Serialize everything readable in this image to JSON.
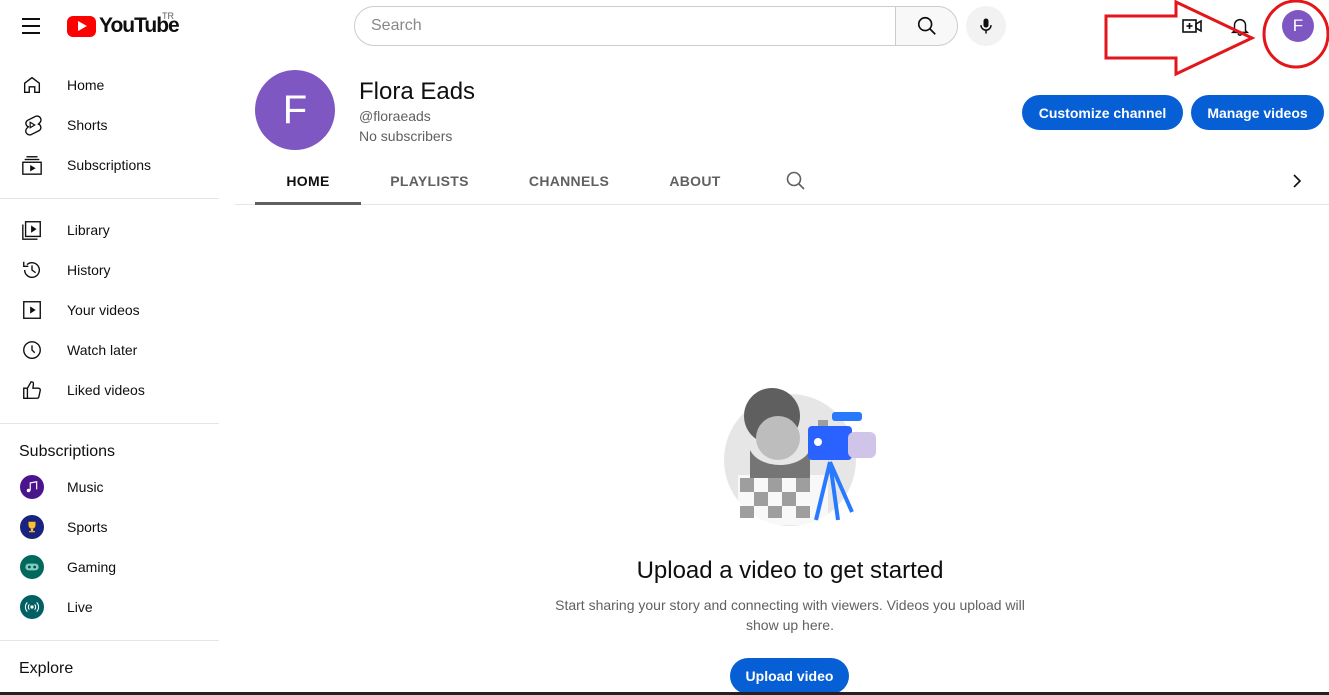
{
  "header": {
    "logo_text": "YouTube",
    "country_code": "TR",
    "search_placeholder": "Search",
    "avatar_letter": "F"
  },
  "sidebar": {
    "main_items": [
      {
        "label": "Home",
        "icon": "home-icon"
      },
      {
        "label": "Shorts",
        "icon": "shorts-icon"
      },
      {
        "label": "Subscriptions",
        "icon": "subscriptions-icon"
      }
    ],
    "library_items": [
      {
        "label": "Library",
        "icon": "library-icon"
      },
      {
        "label": "History",
        "icon": "history-icon"
      },
      {
        "label": "Your videos",
        "icon": "your-videos-icon"
      },
      {
        "label": "Watch later",
        "icon": "watch-later-icon"
      },
      {
        "label": "Liked videos",
        "icon": "liked-videos-icon"
      }
    ],
    "subscriptions_heading": "Subscriptions",
    "subscriptions": [
      {
        "label": "Music",
        "color": "#4a148c"
      },
      {
        "label": "Sports",
        "color": "#1a237e"
      },
      {
        "label": "Gaming",
        "color": "#00695c"
      },
      {
        "label": "Live",
        "color": "#006064"
      }
    ],
    "explore_heading": "Explore"
  },
  "channel": {
    "avatar_letter": "F",
    "name": "Flora Eads",
    "handle": "@floraeads",
    "subscribers": "No subscribers",
    "customize_label": "Customize channel",
    "manage_label": "Manage videos"
  },
  "tabs": [
    {
      "label": "HOME",
      "active": true
    },
    {
      "label": "PLAYLISTS",
      "active": false
    },
    {
      "label": "CHANNELS",
      "active": false
    },
    {
      "label": "ABOUT",
      "active": false
    }
  ],
  "empty_state": {
    "title": "Upload a video to get started",
    "description": "Start sharing your story and connecting with viewers. Videos you upload will show up here.",
    "upload_label": "Upload video"
  },
  "colors": {
    "accent_blue": "#065fd4",
    "avatar_purple": "#7e57c2",
    "annotation_red": "#e3161b",
    "youtube_red": "#ff0000"
  }
}
